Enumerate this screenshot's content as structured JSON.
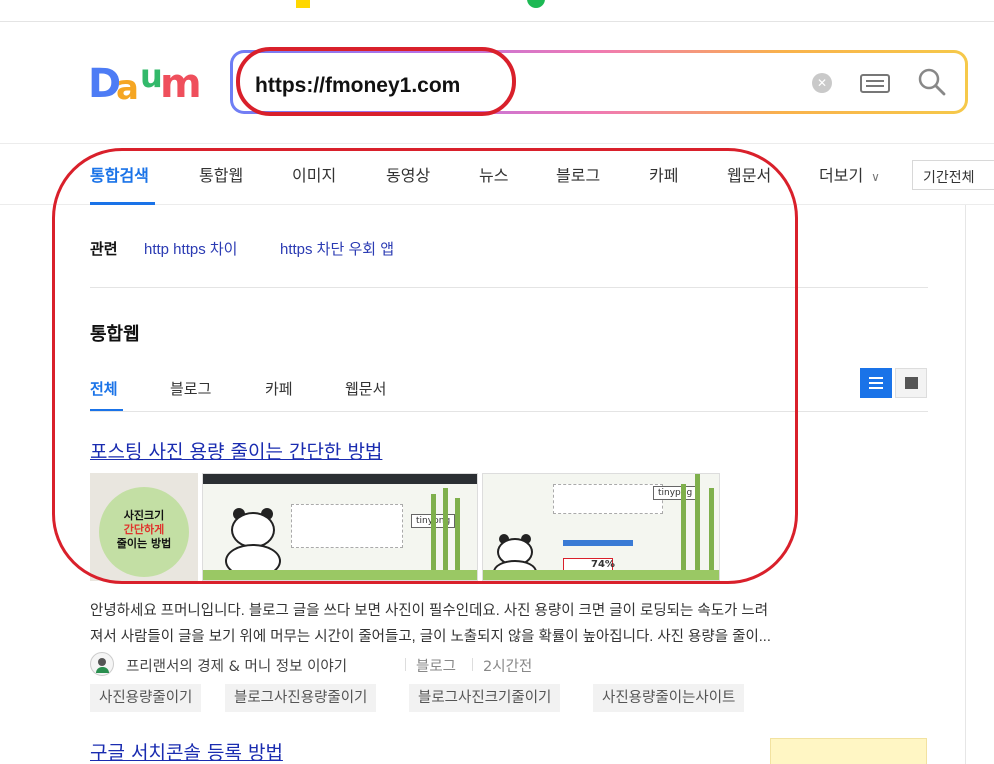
{
  "search": {
    "query": "https://fmoney1.com"
  },
  "logo": {
    "text": "Daum"
  },
  "tabs": [
    {
      "label": "통합검색",
      "active": true
    },
    {
      "label": "통합웹"
    },
    {
      "label": "이미지"
    },
    {
      "label": "동영상"
    },
    {
      "label": "뉴스"
    },
    {
      "label": "블로그"
    },
    {
      "label": "카페"
    },
    {
      "label": "웹문서"
    },
    {
      "label": "더보기"
    }
  ],
  "period": "기간전체",
  "related": {
    "label": "관련",
    "links": [
      "http https 차이",
      "https 차단 우회 앱"
    ]
  },
  "section": {
    "title": "통합웹",
    "subtabs": [
      {
        "label": "전체",
        "active": true
      },
      {
        "label": "블로그"
      },
      {
        "label": "카페"
      },
      {
        "label": "웹문서"
      }
    ]
  },
  "results": [
    {
      "title": "포스팅 사진 용량 줄이는 간단한 방법",
      "thumb1_lines": [
        "사진크기",
        "간단하게",
        "줄이는 방법"
      ],
      "thumb_brand": "tinypng",
      "thumb_stat": "74%",
      "snippet": [
        "안녕하세요 프머니입니다. 블로그 글을 쓰다 보면 사진이 필수인데요. 사진 용량이 크면 글이 로딩되는 속도가 느려",
        "져서 사람들이 글을 보기 위에 머무는 시간이 줄어들고, 글이 노출되지 않을 확률이 높아집니다. 사진 용량을 줄이..."
      ],
      "source": "프리랜서의 경제 & 머니 정보 이야기",
      "type": "블로그",
      "time": "2시간전",
      "tags": [
        "사진용량줄이기",
        "블로그사진용량줄이기",
        "블로그사진크기줄이기",
        "사진용량줄이는사이트"
      ]
    },
    {
      "title": "구글 서치콘솔 등록 방법"
    }
  ],
  "colors": {
    "accent": "#1a73e8",
    "annotation": "#d9202b",
    "link": "#1a2cb0"
  },
  "icons": [
    "clear-icon",
    "keyboard-icon",
    "search-icon",
    "list-view-icon",
    "card-view-icon",
    "chevron-down-icon"
  ]
}
